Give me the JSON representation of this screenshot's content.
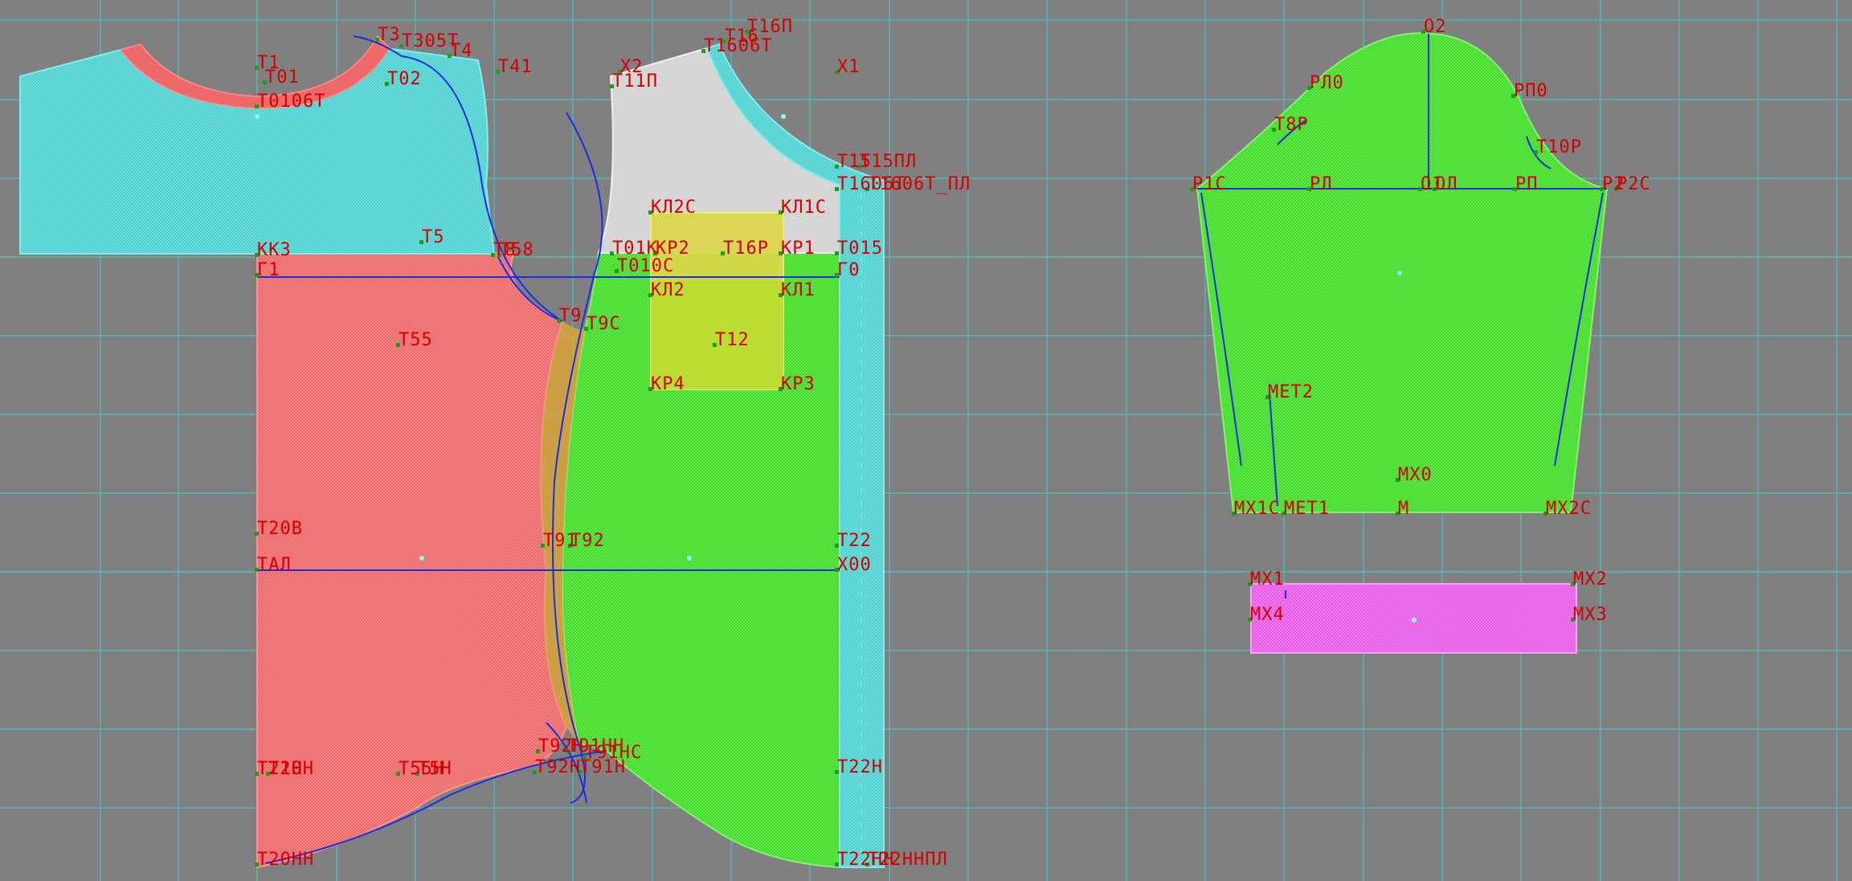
{
  "workspace": {
    "background": "#808080",
    "grid_color": "#4fbfc2"
  },
  "colors": {
    "red_piece": "#ee6a6a",
    "red_edge": "#ff8c8c",
    "cyan_piece": "#50d2d2",
    "green_piece": "#44dd2a",
    "white_piece": "#d2d2d2",
    "yellow_pocket": "#d8d43a",
    "magenta_piece": "#e85fe8",
    "construction_line": "#1a2ee0",
    "point_label": "#d40000",
    "point_marker": "#18a018",
    "center_marker": "#7fffff"
  },
  "pieces": [
    {
      "id": "back-yoke",
      "fill": "cyan_piece"
    },
    {
      "id": "back-body",
      "fill": "red_piece"
    },
    {
      "id": "front-shoulder",
      "fill": "white_piece"
    },
    {
      "id": "front-body",
      "fill": "green_piece"
    },
    {
      "id": "front-placket",
      "fill": "cyan_piece"
    },
    {
      "id": "chest-pocket",
      "fill": "yellow_pocket"
    },
    {
      "id": "sleeve",
      "fill": "green_piece"
    },
    {
      "id": "cuff",
      "fill": "magenta_piece"
    }
  ],
  "labels": {
    "t3": "Т3",
    "t305t": "Т305Т",
    "t4": "Т4",
    "t41": "Т41",
    "t1": "Т1",
    "t01": "Т01",
    "t02": "Т02",
    "t0106t": "Т0106Т",
    "t16p": "Т16П",
    "t16": "Т16",
    "t1606t": "Т1606Т",
    "kh2": "Х2",
    "kh1": "Х1",
    "t11p": "Т11П",
    "t15pl": "Т15ПЛ",
    "t15": "Т15",
    "t1606t_pl": "Т1606Т_ПЛ",
    "t1606t_pl_b": "Т1606Т",
    "kl2s": "КЛ2С",
    "kl1s": "КЛ1С",
    "kk3": "КК3",
    "t5": "Т5",
    "t8": "Т8",
    "t58": "Т58",
    "g1": "Г1",
    "t01k": "Т01К",
    "t010s": "Т010С",
    "kr2": "КР2",
    "t16r": "Т16Р",
    "kr1": "КР1",
    "t015": "Т015",
    "g0": "Г0",
    "kl2": "КЛ2",
    "kl1": "КЛ1",
    "t9": "Т9",
    "t9s": "Т9С",
    "t55": "Т55",
    "t12": "Т12",
    "kr4": "КР4",
    "kr3": "КР3",
    "t20v": "Т20В",
    "t91": "Т91",
    "t92": "Т92",
    "t22": "Т22",
    "tal": "ТАЛ",
    "x00": "Х00",
    "t92n": "Т92Н",
    "t91nn": "Т91НН",
    "t91ns": "Т91НС",
    "t21n": "Т21Н",
    "t20n": "Т20Н",
    "t55n": "Т55Н",
    "t5n": "Т5Н",
    "t92h": "Т92Н",
    "t91h": "Т91Н",
    "t22n": "Т22Н",
    "t20nn": "Т20НН",
    "t22nn": "Т22НН",
    "t22nnpl": "Т22ННПЛ",
    "o2": "О2",
    "rl0": "РЛ0",
    "rp0": "РП0",
    "t8r": "Т8Р",
    "t10r": "Т10Р",
    "r1s": "Р1С",
    "rl": "РЛ",
    "o1": "О1",
    "ol": "ОЛ",
    "rp": "РП",
    "r2": "Р2",
    "r2s": "Р2С",
    "met2": "МЕТ2",
    "mkh0": "МХ0",
    "mkh1s": "МХ1С",
    "met1": "МЕТ1",
    "m": "М",
    "mkh2s": "МХ2С",
    "mkh1": "МХ1",
    "mkh2": "МХ2",
    "mkh4": "МХ4",
    "mkh3": "МХ3"
  }
}
